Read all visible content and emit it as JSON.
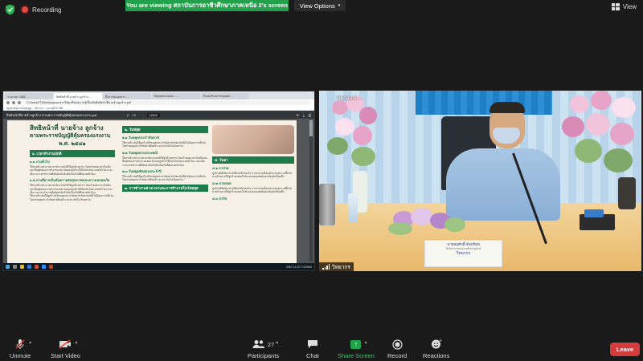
{
  "topbar": {
    "recording": "Recording",
    "viewing": "You are viewing สถาบันการอาชีวศึกษาภาคเหนือ 2's screen",
    "view_options": "View Options",
    "view": "View"
  },
  "share": {
    "tabs": [
      "ร่างภาษา 2562 ...",
      "สิทธิหน้าที่ นายจ้าง ลูกจ้าง...",
      "ถึงการส่งเอกสาร ...",
      "Reported Issue - ...",
      "PowerPoint Template ..."
    ],
    "url": "C:/Users/TTA/Desktop/เอกสารวิจัยเตรียม/ความรู้เบื้องต้นสิทธิหน้าที่นายจ้างลูกจ้าง.pdf",
    "bookmarks": "Apps   https://emoji.gg...   หน้าแรก - คุณวุฒิวิชาชีพ",
    "pdf_name": "สิทธิหน้าที่นายจ้างลูกจ้าง ตามพระราชบัญญัติคุ้มครองแรงงาน.pdf",
    "page": "2",
    "pages": "/ 9",
    "zoom": "125%",
    "doc": {
      "title_line1": "สิทธิหน้าที่ นายจ้าง ลูกจ้าง",
      "title_line2": "ตามพระราชบัญญัติคุ้มครองแรงงาน",
      "title_line3": "พ.ศ. ๒๕๔๑",
      "sec1": "๑. เวลาทำงานปกติ",
      "sec1_sub1": "๑.๑ งานทั่วไป",
      "sec1_sub2": "๑.๒ งานที่อาจเป็นอันตรายต่อสุขภาพและความปลอดภัย",
      "sec1_text": "ให้นายจ้างประกาศเวลาทำงานปกติให้ลูกจ้างทราบ โดยกำหนดเวลาเริ่มต้นและสิ้นสุดของการทำงานแต่ละวันของลูกจ้างได้ไม่เกินวันละแปดชั่วโมง และเมื่อรวมเวลาทำงานทั้งสัปดาห์แล้วต้องไม่เกินสี่สิบแปดชั่วโมง",
      "sec2": "๒. วันหยุด",
      "sec2_sub1": "๒.๑ วันหยุดประจำสัปดาห์",
      "sec2_sub2": "๒.๒ วันหยุดตามประเพณี",
      "sec2_sub3": "๒.๓ วันหยุดพักผ่อนประจำปี",
      "sec2_text": "ให้นายจ้างจัดให้ลูกจ้างมีวันหยุดประจำสัปดาห์ สัปดาห์หนึ่งไม่น้อยกว่าหนึ่งวัน โดยวันหยุดประจำสัปดาห์ต้องมีระยะห่างกันไม่เกินหกวัน",
      "sec3": "๓. การทำงานล่วงเวลาและการทำงานในวันหยุด",
      "sec4": "๔. วันลา",
      "sec4_sub1": "๔.๑ ลาป่วย",
      "sec4_sub2": "๔.๒ ลาคลอด",
      "sec4_sub3": "๔.๓ ลากิจ",
      "sec4_text": "ลูกจ้างมีสิทธิลาป่วยได้เท่าที่ป่วยจริง การลาป่วยตั้งแต่สามวันทำงานขึ้นไป นายจ้างอาจให้ลูกจ้างแสดงใบรับรองของแพทย์แผนปัจจุบันชั้นหนึ่ง"
    },
    "taskbar_right": "ENG  11:02  7/1/2564"
  },
  "video": {
    "top_label": "Rename ...",
    "participant": "วิทยากร",
    "card_line1": "นายสมศักดิ์ จันทร์สุข",
    "card_line2": "นักวิชาการแรงงานชำนาญการ",
    "card_line3": "วิทยากร"
  },
  "toolbar": {
    "unmute": "Unmute",
    "start_video": "Start Video",
    "participants": "Participants",
    "participants_count": "27",
    "chat": "Chat",
    "share_screen": "Share Screen",
    "record": "Record",
    "reactions": "Reactions",
    "leave": "Leave"
  },
  "colors": {
    "share_green": "#22a04b",
    "leave_red": "#d23c3c",
    "accent_green_text": "#3fc26b"
  }
}
